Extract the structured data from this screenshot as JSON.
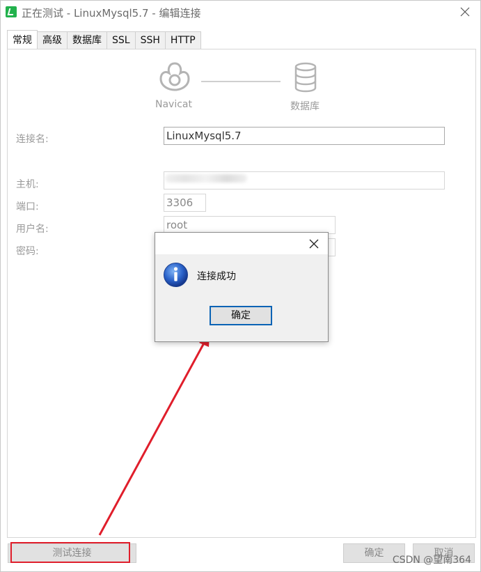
{
  "window": {
    "title": "正在测试 - LinuxMysql5.7 - 编辑连接"
  },
  "tabs": [
    {
      "label": "常规",
      "active": true
    },
    {
      "label": "高级",
      "active": false
    },
    {
      "label": "数据库",
      "active": false
    },
    {
      "label": "SSL",
      "active": false
    },
    {
      "label": "SSH",
      "active": false
    },
    {
      "label": "HTTP",
      "active": false
    }
  ],
  "header": {
    "left_label": "Navicat",
    "right_label": "数据库"
  },
  "form": {
    "connection_name_label": "连接名:",
    "connection_name_value": "LinuxMysql5.7",
    "host_label": "主机:",
    "host_value": "",
    "port_label": "端口:",
    "port_value": "3306",
    "user_label": "用户名:",
    "user_value": "root",
    "password_label": "密码:"
  },
  "buttons": {
    "test": "测试连接",
    "ok": "确定",
    "cancel": "取消"
  },
  "dialog": {
    "message": "连接成功",
    "ok": "确定"
  },
  "watermark": "CSDN @望南364",
  "colors": {
    "highlight": "#e01e2b",
    "arrow": "#e01e2b",
    "ok_border": "#0a63b5"
  }
}
